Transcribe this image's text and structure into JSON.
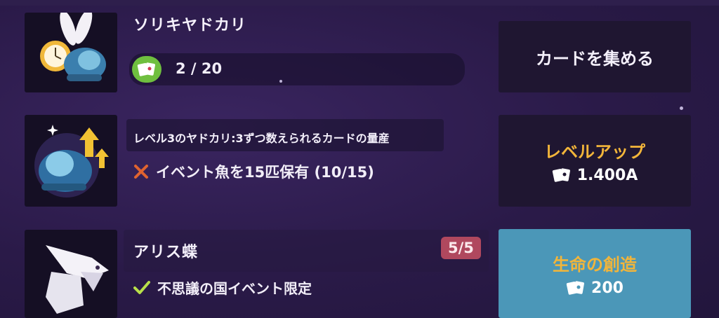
{
  "row1": {
    "title": "ソリキヤドカリ",
    "progress_text": "2 / 20",
    "button_label": "カードを集める"
  },
  "row2": {
    "description": "レベル3のヤドカリ:3ずつ数えられるカードの量産",
    "requirement": "イベント魚を15匹保有 (10/15)",
    "button_label": "レベルアップ",
    "button_cost": "1.400A"
  },
  "row3": {
    "title": "アリス蝶",
    "badge": "5/5",
    "requirement": "不思議の国イベント限定",
    "button_label": "生命の創造",
    "button_cost": "200"
  },
  "colors": {
    "background": "#2a1a48",
    "button_dark": "#1f1631",
    "button_teal": "#4b97b8",
    "gold_text": "#f2b53a",
    "badge": "#b0485e",
    "check": "#b8e04a",
    "cross": "#e0632f",
    "chip_green": "#6fbf3f"
  },
  "icons": [
    "card-deck-icon",
    "cross-icon",
    "check-icon",
    "level-up-arrows-icon"
  ]
}
